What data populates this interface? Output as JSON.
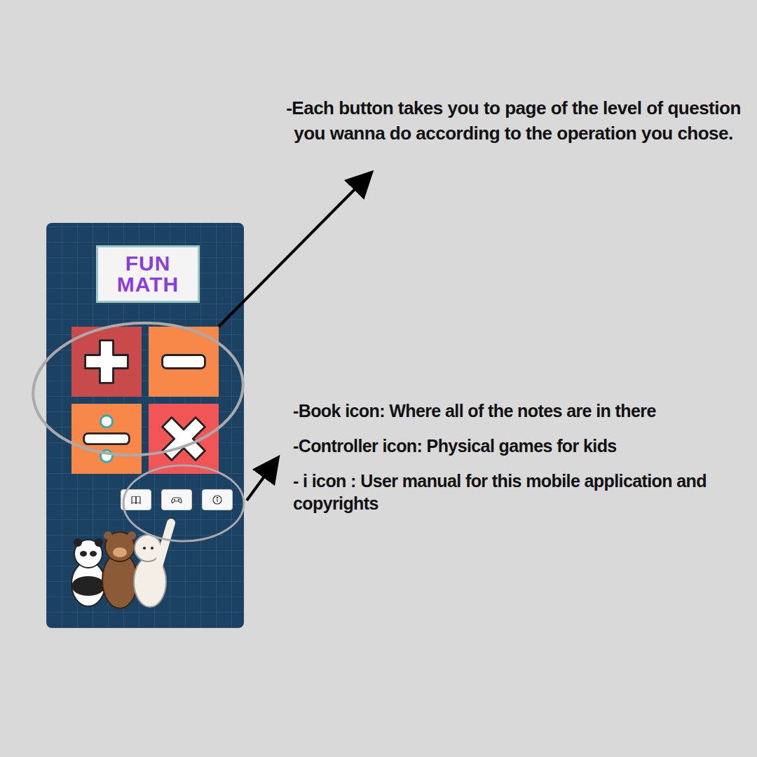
{
  "app": {
    "logo": {
      "lines": [
        "FUN",
        "MATH"
      ]
    },
    "operations": [
      {
        "kind": "plus",
        "color": "#c94a4a"
      },
      {
        "kind": "minus",
        "color": "#f7884a"
      },
      {
        "kind": "divide",
        "color": "#f7884a"
      },
      {
        "kind": "multiply",
        "color": "#f25555"
      }
    ],
    "toolbar": [
      {
        "kind": "book"
      },
      {
        "kind": "controller"
      },
      {
        "kind": "info"
      }
    ]
  },
  "notes": {
    "operations": "-Each button takes you to page of the level of question you wanna do according to the operation you chose.",
    "toolbar": [
      "-Book icon: Where all of the notes are in there",
      "-Controller icon: Physical games for kids",
      "- i icon : User manual for this mobile application and copyrights"
    ]
  }
}
